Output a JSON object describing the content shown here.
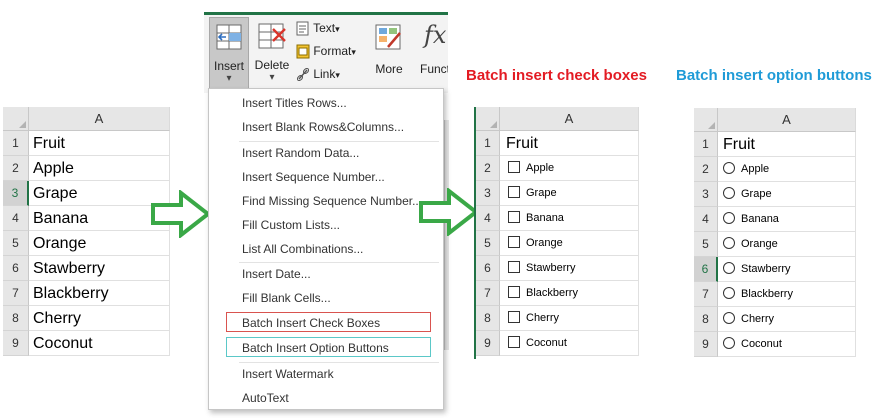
{
  "titles": {
    "checkbox": "Batch insert check boxes",
    "option": "Batch insert option buttons"
  },
  "colors": {
    "excel_green": "#217346",
    "arrow_green": "#3aa847",
    "title_red": "#e31b23",
    "title_blue": "#1f9bd7",
    "box_red": "#d9534f",
    "box_teal": "#5bc8c8"
  },
  "left_sheet": {
    "column": "A",
    "rows": [
      {
        "num": "1",
        "text": "Fruit"
      },
      {
        "num": "2",
        "text": "Apple"
      },
      {
        "num": "3",
        "text": "Grape"
      },
      {
        "num": "4",
        "text": "Banana"
      },
      {
        "num": "5",
        "text": "Orange"
      },
      {
        "num": "6",
        "text": "Stawberry"
      },
      {
        "num": "7",
        "text": "Blackberry"
      },
      {
        "num": "8",
        "text": "Cherry"
      },
      {
        "num": "9",
        "text": "Coconut"
      }
    ]
  },
  "ribbon": {
    "insert": "Insert",
    "delete": "Delete",
    "text": "Text",
    "format": "Format",
    "link": "Link",
    "more": "More",
    "functions": "Functi",
    "fx_glyph": "fx",
    "dropdown_arrow": "▾"
  },
  "menu": {
    "items": [
      "Insert Titles Rows...",
      "Insert Blank Rows&Columns...",
      "Insert Random Data...",
      "Insert Sequence Number...",
      "Find Missing Sequence Number...",
      "Fill Custom Lists...",
      "List All Combinations...",
      "Insert Date...",
      "Fill Blank Cells...",
      "Batch Insert Check Boxes",
      "Batch Insert Option Buttons",
      "Insert Watermark",
      "AutoText"
    ]
  },
  "checkbox_sheet": {
    "column": "A",
    "rows": [
      {
        "num": "1",
        "text": "Fruit"
      },
      {
        "num": "2",
        "text": "Apple"
      },
      {
        "num": "3",
        "text": "Grape"
      },
      {
        "num": "4",
        "text": "Banana"
      },
      {
        "num": "5",
        "text": "Orange"
      },
      {
        "num": "6",
        "text": "Stawberry"
      },
      {
        "num": "7",
        "text": "Blackberry"
      },
      {
        "num": "8",
        "text": "Cherry"
      },
      {
        "num": "9",
        "text": "Coconut"
      }
    ]
  },
  "option_sheet": {
    "column": "A",
    "rows": [
      {
        "num": "1",
        "text": "Fruit"
      },
      {
        "num": "2",
        "text": "Apple"
      },
      {
        "num": "3",
        "text": "Grape"
      },
      {
        "num": "4",
        "text": "Banana"
      },
      {
        "num": "5",
        "text": "Orange"
      },
      {
        "num": "6",
        "text": "Stawberry"
      },
      {
        "num": "7",
        "text": "Blackberry"
      },
      {
        "num": "8",
        "text": "Cherry"
      },
      {
        "num": "9",
        "text": "Coconut"
      }
    ]
  }
}
